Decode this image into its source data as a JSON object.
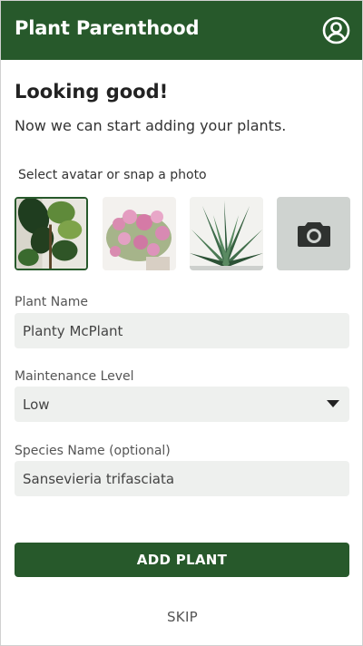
{
  "header": {
    "title": "Plant Parenthood",
    "profile_icon": "user-circle-icon"
  },
  "intro": {
    "heading": "Looking good!",
    "subtitle": "Now we can start adding your plants."
  },
  "avatar_picker": {
    "label": "Select avatar or snap a photo",
    "options": [
      {
        "name": "fiddle-leaf-fig-photo",
        "selected": true
      },
      {
        "name": "pink-flowers-photo",
        "selected": false
      },
      {
        "name": "aloe-succulent-photo",
        "selected": false
      },
      {
        "name": "camera-icon",
        "selected": false
      }
    ]
  },
  "form": {
    "plant_name": {
      "label": "Plant Name",
      "value": "Planty McPlant"
    },
    "maintenance": {
      "label": "Maintenance Level",
      "value": "Low"
    },
    "species": {
      "label": "Species Name (optional)",
      "value": "Sansevieria trifasciata"
    }
  },
  "actions": {
    "add_label": "ADD PLANT",
    "skip_label": "SKIP"
  },
  "colors": {
    "brand_green": "#27592b",
    "field_bg": "#eef0ee",
    "camera_tile": "#cfd3d0"
  }
}
